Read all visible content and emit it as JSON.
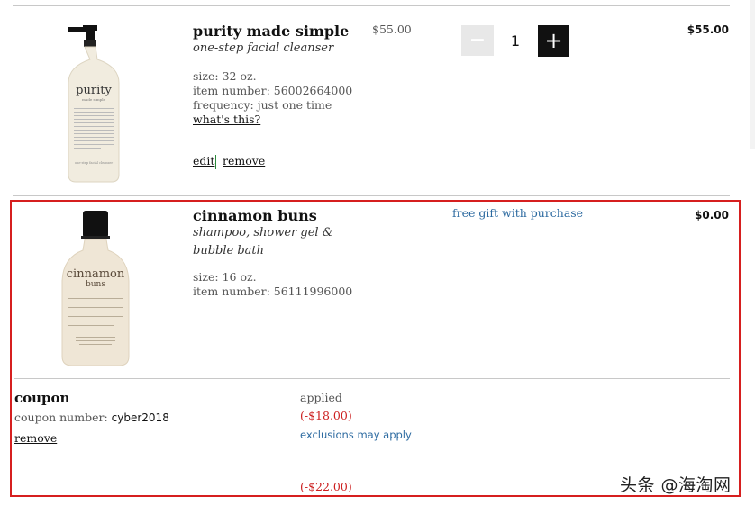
{
  "cart": {
    "items": [
      {
        "name": "purity made simple",
        "subtitle": "one-step facial cleanser",
        "size": "size: 32 oz.",
        "item_number": "item number: 56002664000",
        "frequency": "frequency: just one time",
        "whats_this": "what's this?",
        "edit": "edit",
        "remove": "remove",
        "unit_price": "$55.00",
        "quantity": "1",
        "total": "$55.00",
        "bottle_label": "purity",
        "bottle_sublabel": "made simple",
        "bottle_footer": "one-step facial cleanser"
      },
      {
        "name": "cinnamon buns",
        "subtitle": "shampoo, shower gel & bubble bath",
        "size": "size: 16 oz.",
        "item_number": "item number: 56111996000",
        "gift_note": "free gift with purchase",
        "total": "$0.00",
        "bottle_label": "cinnamon",
        "bottle_sublabel": "buns"
      }
    ],
    "quantity_controls": {
      "minus": "−",
      "plus": "+"
    }
  },
  "coupon": {
    "title": "coupon",
    "number_label": "coupon number:",
    "code": "cyber2018",
    "remove": "remove",
    "status": "applied",
    "discount": "(-$18.00)",
    "exclusions": "exclusions may apply",
    "total_discount": "(-$22.00)"
  },
  "watermark": "头条 @海淘网",
  "colors": {
    "highlight": "#d61f1f",
    "link_blue": "#2c6aa0",
    "discount_red": "#cc1f1f"
  }
}
